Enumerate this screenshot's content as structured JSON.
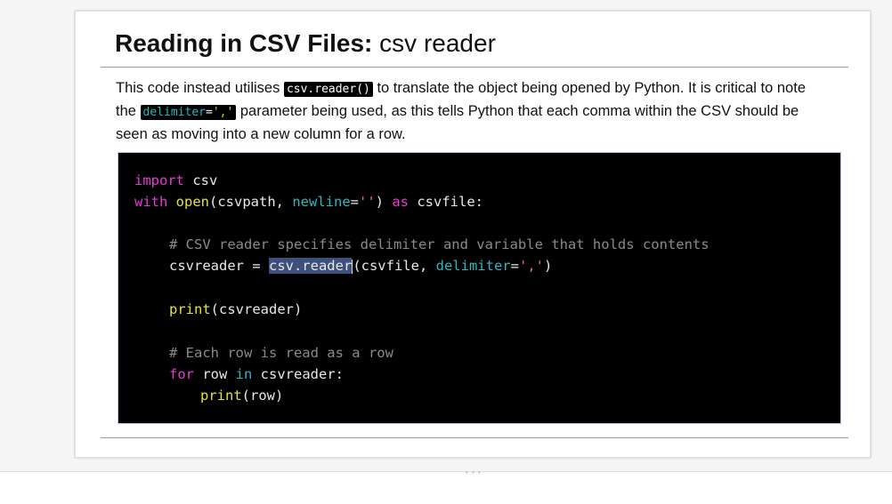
{
  "slide": {
    "title_bold": "Reading in CSV Files:",
    "title_rest": " csv reader",
    "description": {
      "part1": "This code instead utilises ",
      "chip1": "csv.reader()",
      "part2": " to translate the object being opened by Python. It is critical to note the ",
      "chip2_kw": "delimiter",
      "chip2_eq": "=",
      "chip2_str": "','",
      "part3": " parameter being used, as this tells Python that each comma within the CSV should be seen as moving into a new column for a row."
    }
  },
  "code": {
    "line1": {
      "kw": "import",
      "rest": " csv"
    },
    "line2": {
      "kw": "with",
      "fn": "open",
      "a": "(csvpath, ",
      "param": "newline",
      "eq": "=",
      "str": "''",
      "b": ") ",
      "kw2": "as",
      "c": " csvfile:"
    },
    "line3": {
      "comment": "# CSV reader specifies delimiter and variable that holds contents"
    },
    "line4": {
      "a": "csvreader = ",
      "sel": "csv.reader",
      "b": "(csvfile, ",
      "param": "delimiter",
      "eq": "=",
      "str": "','",
      "c": ")"
    },
    "line5": {
      "fn": "print",
      "rest": "(csvreader)"
    },
    "line6": {
      "comment": "# Each row is read as a row"
    },
    "line7": {
      "kw": "for",
      "a": " row ",
      "kw2": "in",
      "b": " csvreader:"
    },
    "line8": {
      "fn": "print",
      "rest": "(row)"
    }
  },
  "colors": {
    "keyword": "#e63ad8",
    "function": "#e8e040",
    "parameter": "#2fb8bf",
    "string": "#e86a6a",
    "comment": "#8a8a8a",
    "selection": "#3d4f7c"
  }
}
